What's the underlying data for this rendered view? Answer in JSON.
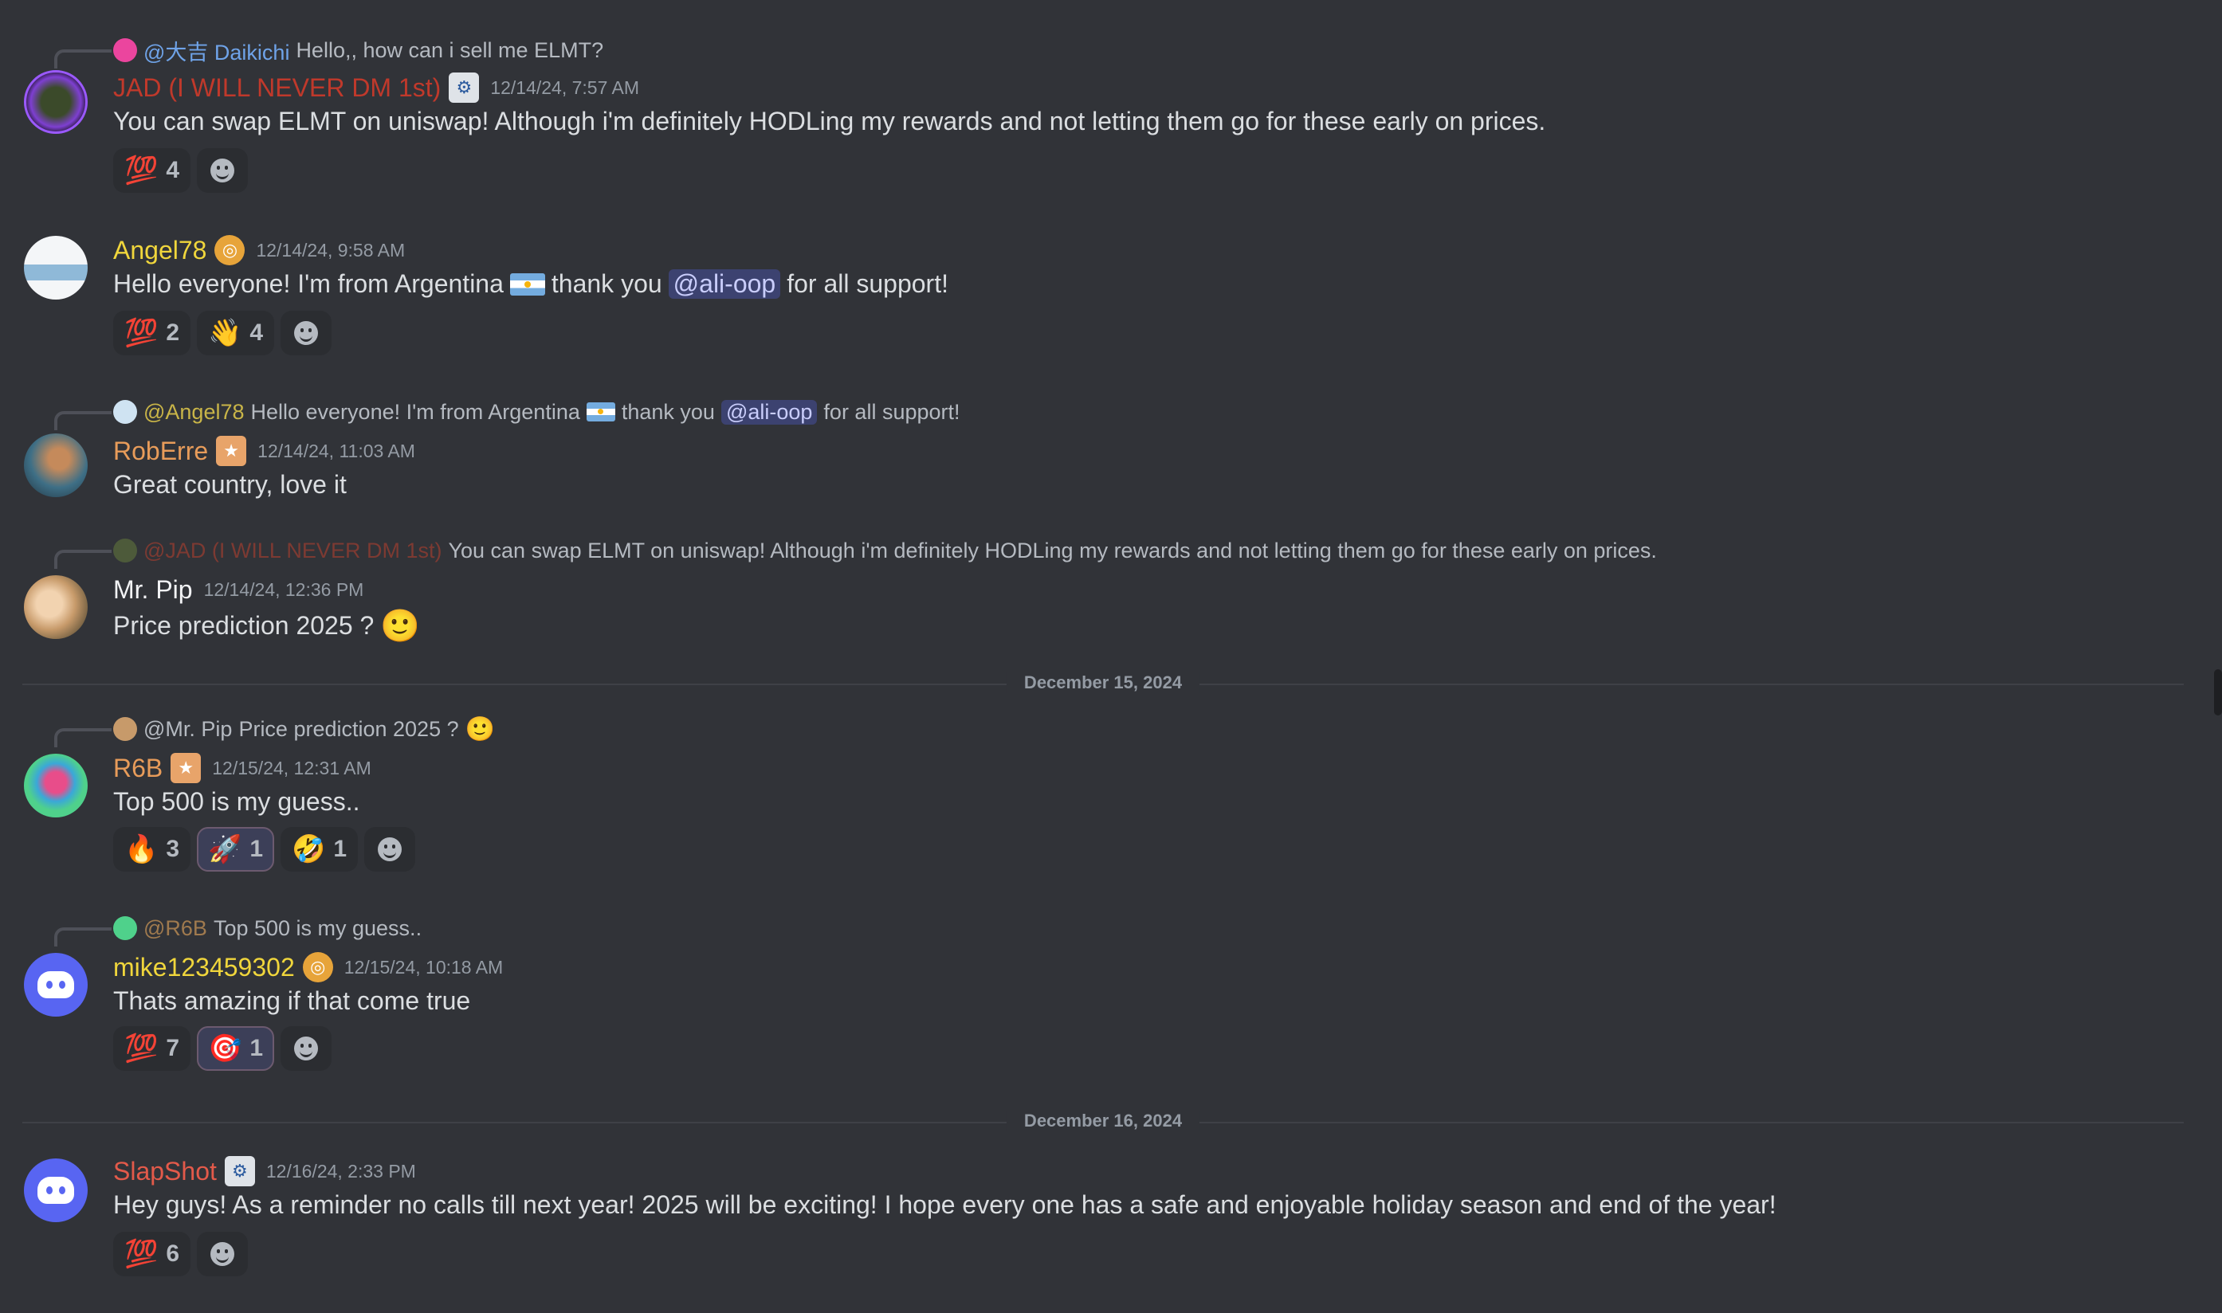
{
  "colors": {
    "background": "#313338",
    "text": "#dbdee1",
    "muted": "#949ba4",
    "mention_bg": "#3c4270",
    "name_red": "#e35a4a",
    "name_yellow": "#f0d63c",
    "name_orange": "#e89c5a",
    "name_white": "#f2f3f5",
    "name_blue": "#6fa3e8"
  },
  "messages": [
    {
      "reply": {
        "to": "@大吉 Daikichi",
        "text": "Hello,, how can i sell me ELMT?"
      },
      "author": "JAD (I WILL NEVER DM 1st)",
      "timestamp": "12/14/24, 7:57 AM",
      "content": "You can swap ELMT on uniswap! Although i'm definitely HODLing my rewards and not letting them go for these early on prices.",
      "reactions": [
        {
          "emoji": "💯",
          "count": "4"
        }
      ]
    },
    {
      "author": "Angel78",
      "timestamp": "12/14/24, 9:58 AM",
      "content_a": "Hello everyone! I'm from Argentina",
      "content_b": "thank you",
      "mention": "@ali-oop",
      "content_c": "for all support!",
      "reactions": [
        {
          "emoji": "💯",
          "count": "2"
        },
        {
          "emoji": "👋",
          "count": "4"
        }
      ]
    },
    {
      "reply": {
        "to": "@Angel78",
        "text_a": "Hello everyone! I'm from Argentina",
        "text_b": "thank you",
        "mention": "@ali-oop",
        "text_c": "for all support!"
      },
      "author": "RobErre",
      "timestamp": "12/14/24, 11:03 AM",
      "content": "Great country, love it"
    },
    {
      "reply": {
        "to": "@JAD (I WILL NEVER DM 1st)",
        "text": "You can swap ELMT on uniswap! Although i'm definitely HODLing my rewards and not letting them go for these early on prices."
      },
      "author": "Mr. Pip",
      "timestamp": "12/14/24, 12:36 PM",
      "content": "Price prediction 2025 ?",
      "content_emoji": "🙂"
    },
    {
      "reply": {
        "to": "@Mr. Pip",
        "text": "Price prediction 2025 ?",
        "emoji": "🙂"
      },
      "author": "R6B",
      "timestamp": "12/15/24, 12:31 AM",
      "content": "Top 500 is my guess..",
      "reactions": [
        {
          "emoji": "🔥",
          "count": "3"
        },
        {
          "emoji": "🚀",
          "count": "1"
        },
        {
          "emoji": "🤣",
          "count": "1"
        }
      ]
    },
    {
      "reply": {
        "to": "@R6B",
        "text": "Top 500 is my guess.."
      },
      "author": "mike123459302",
      "timestamp": "12/15/24, 10:18 AM",
      "content": "Thats amazing if that come true",
      "reactions": [
        {
          "emoji": "💯",
          "count": "7"
        },
        {
          "emoji": "🎯",
          "count": "1"
        }
      ]
    },
    {
      "author": "SlapShot",
      "timestamp": "12/16/24, 2:33 PM",
      "content": "Hey guys! As a reminder no calls till next year! 2025 will be exciting! I hope every one has a safe and enjoyable holiday season and end of the year!",
      "reactions": [
        {
          "emoji": "💯",
          "count": "6"
        }
      ]
    }
  ],
  "dividers": [
    "December 15, 2024",
    "December 16, 2024"
  ]
}
